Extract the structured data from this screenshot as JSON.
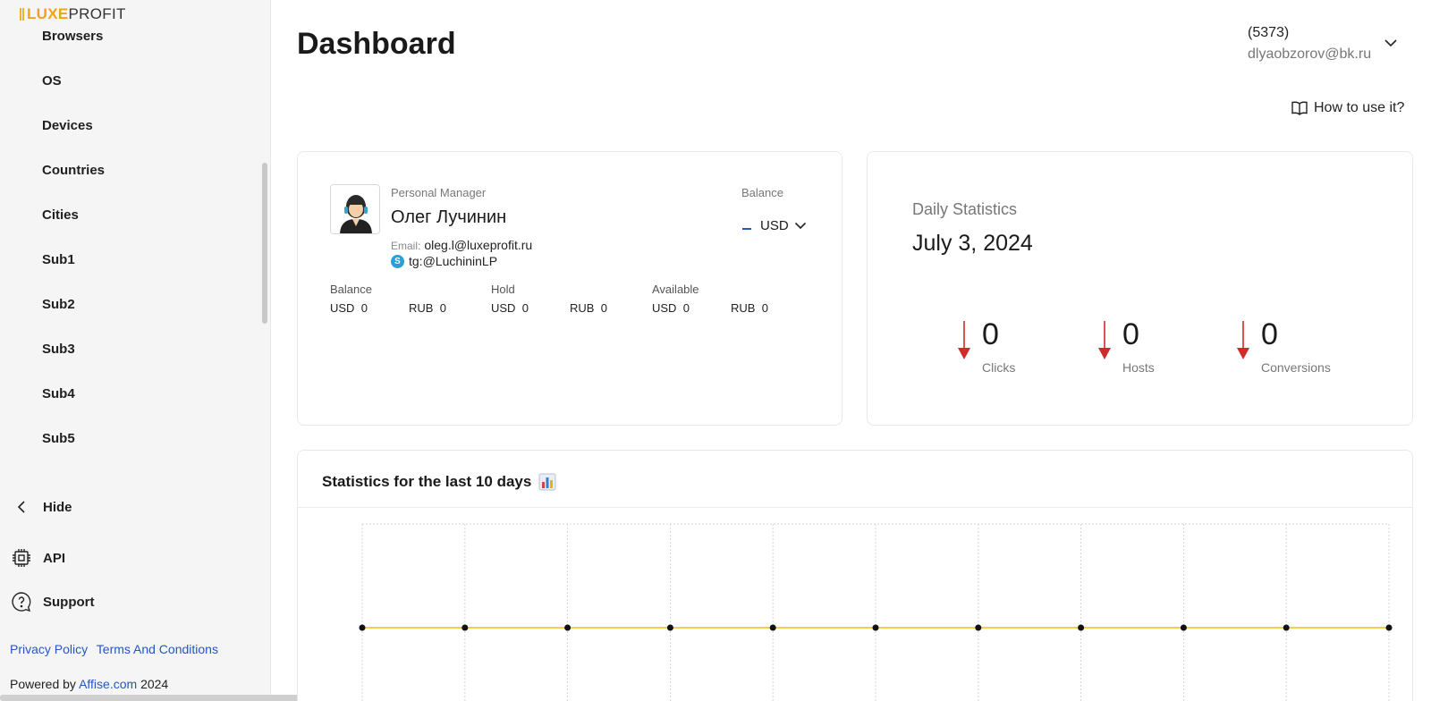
{
  "brand": {
    "logo_bold": "LUXE",
    "logo_light": "PROFIT"
  },
  "sidebar": {
    "items": [
      {
        "label": "Browsers"
      },
      {
        "label": "OS"
      },
      {
        "label": "Devices"
      },
      {
        "label": "Countries"
      },
      {
        "label": "Cities"
      },
      {
        "label": "Sub1"
      },
      {
        "label": "Sub2"
      },
      {
        "label": "Sub3"
      },
      {
        "label": "Sub4"
      },
      {
        "label": "Sub5"
      }
    ],
    "hide_label": "Hide",
    "api_label": "API",
    "support_label": "Support",
    "footer": {
      "privacy": "Privacy Policy",
      "terms": "Terms And Conditions",
      "powered_prefix": "Powered by",
      "powered_link": "Affise.com",
      "year": "2024"
    }
  },
  "header": {
    "title": "Dashboard",
    "user_id": "(5373)",
    "user_email": "dlyaobzorov@bk.ru",
    "howto_label": "How to use it?"
  },
  "manager": {
    "label": "Personal Manager",
    "name": "Олег Лучинин",
    "email_label": "Email:",
    "email": "oleg.l@luxeprofit.ru",
    "telegram": "tg:@LuchininLP",
    "balance_label": "Balance",
    "currency": "USD"
  },
  "balances": [
    {
      "title": "Balance",
      "usd_label": "USD",
      "usd": "0",
      "rub_label": "RUB",
      "rub": "0"
    },
    {
      "title": "Hold",
      "usd_label": "USD",
      "usd": "0",
      "rub_label": "RUB",
      "rub": "0"
    },
    {
      "title": "Available",
      "usd_label": "USD",
      "usd": "0",
      "rub_label": "RUB",
      "rub": "0"
    }
  ],
  "daily": {
    "title": "Daily Statistics",
    "date": "July 3, 2024",
    "metrics": [
      {
        "value": "0",
        "label": "Clicks"
      },
      {
        "value": "0",
        "label": "Hosts"
      },
      {
        "value": "0",
        "label": "Conversions"
      }
    ],
    "arrow_color": "#d12a2a"
  },
  "stats": {
    "title": "Statistics for the last 10 days"
  },
  "chart_data": {
    "type": "line",
    "x": [
      1,
      2,
      3,
      4,
      5,
      6,
      7,
      8,
      9,
      10,
      11
    ],
    "series": [
      {
        "values": [
          0,
          0,
          0,
          0,
          0,
          0,
          0,
          0,
          0,
          0,
          0
        ],
        "color": "#e8c21a"
      }
    ],
    "grid": true
  },
  "colors": {
    "accent": "#f2a31c",
    "link": "#2456c4"
  }
}
